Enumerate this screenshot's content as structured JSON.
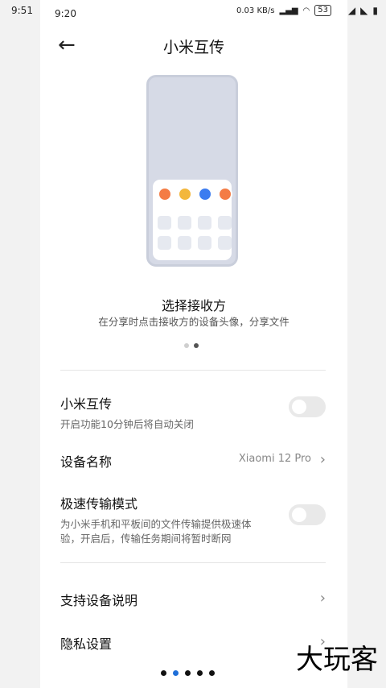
{
  "host_status": {
    "time": "9:51"
  },
  "status": {
    "time": "9:20",
    "network_speed": "0.03 KB/s",
    "battery": "53"
  },
  "header": {
    "title": "小米互传",
    "back_icon": "←"
  },
  "illustration": {
    "avatar_colors": [
      "#f47c45",
      "#f3b73c",
      "#3c7cf0",
      "#f47c45"
    ]
  },
  "feature": {
    "title": "选择接收方",
    "description": "在分享时点击接收方的设备头像，分享文件"
  },
  "settings": {
    "xiaomi_share": {
      "label": "小米互传",
      "sub": "开启功能10分钟后将自动关闭",
      "enabled": false
    },
    "device_name": {
      "label": "设备名称",
      "value": "Xiaomi 12 Pro"
    },
    "fast_mode": {
      "label": "极速传输模式",
      "sub": "为小米手机和平板间的文件传输提供极速体验，开启后，传输任务期间将暂时断网",
      "enabled": false
    },
    "support_devices": {
      "label": "支持设备说明"
    },
    "privacy": {
      "label": "隐私设置"
    }
  },
  "watermark": "大玩客"
}
